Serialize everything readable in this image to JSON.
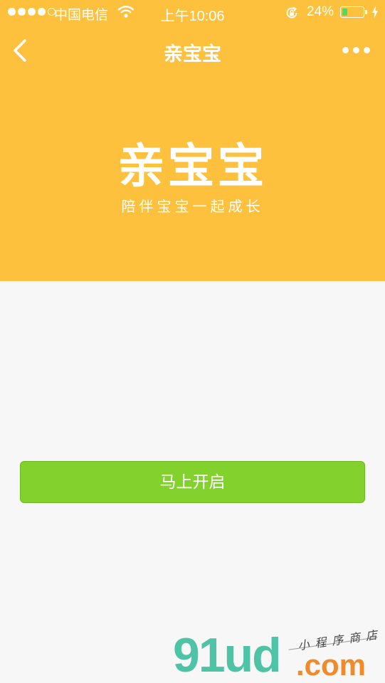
{
  "status_bar": {
    "carrier": "中国电信",
    "time": "上午10:06",
    "battery_percent": "24%",
    "battery_level": 0.24,
    "signal_bars_filled": 4,
    "signal_bars_total": 5,
    "icons": [
      "signal-dots-icon",
      "wifi-icon",
      "rotation-lock-icon",
      "battery-icon",
      "charging-bolt-icon"
    ]
  },
  "nav": {
    "title": "亲宝宝",
    "back_icon": "chevron-left-icon",
    "more_icon": "more-dots-icon"
  },
  "brand": {
    "title": "亲宝宝",
    "slogan": "陪伴宝宝一起成长"
  },
  "actions": {
    "start_label": "马上开启"
  },
  "watermark": {
    "logo": "91ud",
    "tagline": "小程序商店",
    "domain": ".com"
  },
  "colors": {
    "header": "#fec13d",
    "background": "#f7f7f7",
    "button": "#82d12d",
    "battery": "#4cd964",
    "watermark_logo": "#4fc3a5",
    "watermark_domain": "#f08a2b"
  }
}
